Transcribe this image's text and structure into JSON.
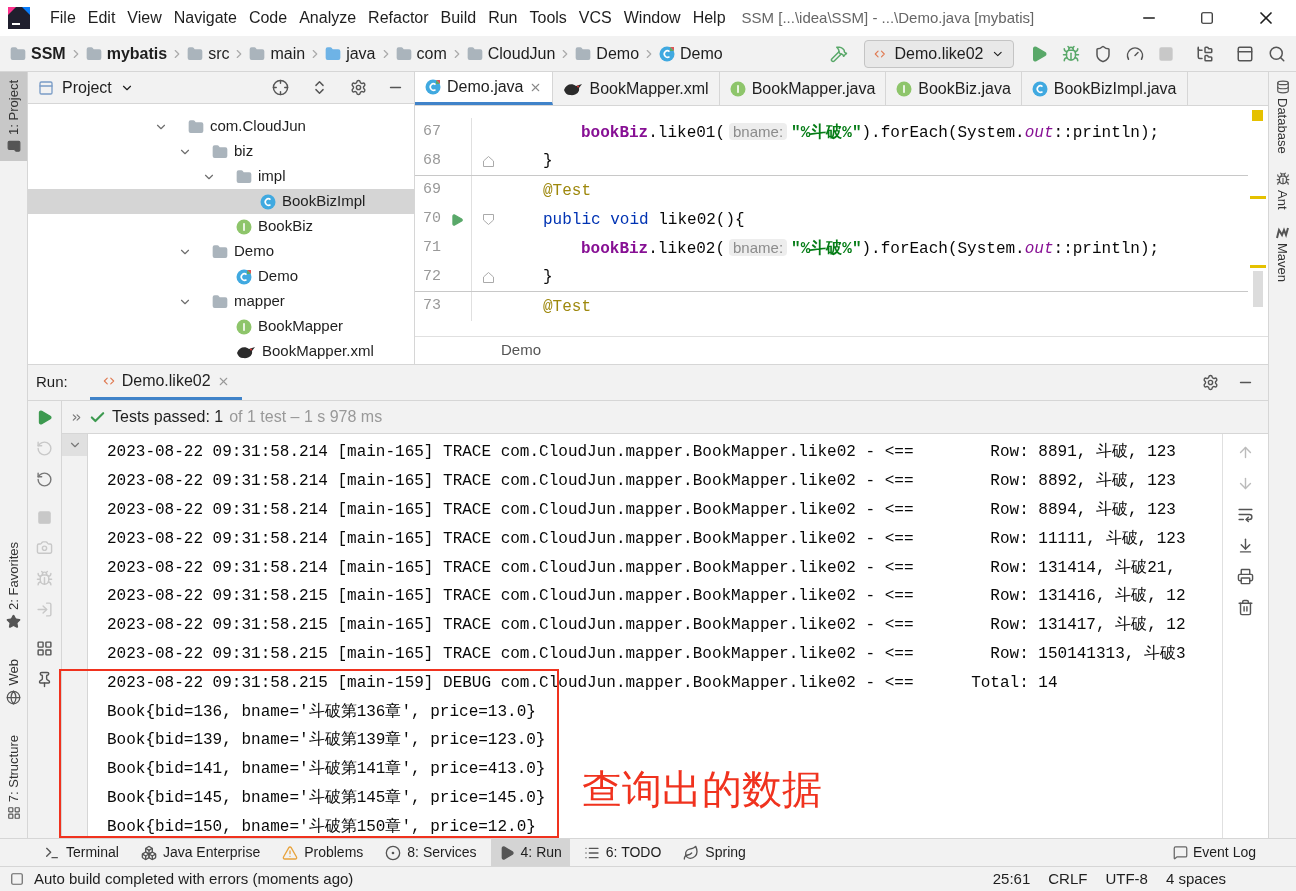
{
  "title_bar": {
    "menu": [
      "File",
      "Edit",
      "View",
      "Navigate",
      "Code",
      "Analyze",
      "Refactor",
      "Build",
      "Run",
      "Tools",
      "VCS",
      "Window",
      "Help"
    ],
    "title": "SSM [...\\idea\\SSM] - ...\\Demo.java [mybatis]"
  },
  "nav_bar": {
    "breadcrumbs": [
      {
        "label": "SSM",
        "kind": "module"
      },
      {
        "label": "mybatis",
        "kind": "module"
      },
      {
        "label": "src",
        "kind": "folder"
      },
      {
        "label": "main",
        "kind": "folder"
      },
      {
        "label": "java",
        "kind": "source"
      },
      {
        "label": "com",
        "kind": "folder"
      },
      {
        "label": "CloudJun",
        "kind": "folder"
      },
      {
        "label": "Demo",
        "kind": "folder"
      },
      {
        "label": "Demo",
        "kind": "class"
      }
    ],
    "run_config": "Demo.like02"
  },
  "left_strip": {
    "tabs": [
      {
        "label": "1: Project",
        "kind": "project",
        "selected": true
      },
      {
        "label": "2: Favorites",
        "kind": "favorites",
        "selected": false
      },
      {
        "label": "Web",
        "kind": "web",
        "selected": false
      },
      {
        "label": "7: Structure",
        "kind": "structure",
        "selected": false
      }
    ]
  },
  "right_strip": {
    "tabs": [
      {
        "label": "Database",
        "kind": "database"
      },
      {
        "label": "Ant",
        "kind": "ant"
      },
      {
        "label": "Maven",
        "kind": "maven"
      }
    ]
  },
  "project_panel": {
    "title": "Project",
    "tree": [
      {
        "label": "com.CloudJun",
        "kind": "package",
        "expanded": true,
        "selected": false,
        "children": [
          {
            "label": "biz",
            "kind": "package",
            "expanded": true,
            "selected": false,
            "children": [
              {
                "label": "impl",
                "kind": "package",
                "expanded": true,
                "selected": false,
                "children": [
                  {
                    "label": "BookBizImpl",
                    "kind": "class",
                    "selected": true
                  }
                ]
              },
              {
                "label": "BookBiz",
                "kind": "interface",
                "selected": false
              }
            ]
          },
          {
            "label": "Demo",
            "kind": "package",
            "expanded": true,
            "selected": false,
            "children": [
              {
                "label": "Demo",
                "kind": "test-class",
                "selected": false
              }
            ]
          },
          {
            "label": "mapper",
            "kind": "package",
            "expanded": true,
            "selected": false,
            "children": [
              {
                "label": "BookMapper",
                "kind": "interface",
                "selected": false
              },
              {
                "label": "BookMapper.xml",
                "kind": "xml",
                "selected": false
              }
            ]
          }
        ]
      }
    ]
  },
  "editor": {
    "tabs": [
      {
        "label": "Demo.java",
        "kind": "test-class",
        "selected": true
      },
      {
        "label": "BookMapper.xml",
        "kind": "xml",
        "selected": false
      },
      {
        "label": "BookMapper.java",
        "kind": "interface",
        "selected": false
      },
      {
        "label": "BookBiz.java",
        "kind": "interface",
        "selected": false
      },
      {
        "label": "BookBizImpl.java",
        "kind": "class",
        "selected": false
      }
    ],
    "lines": [
      {
        "number": "67",
        "kind": "statement",
        "run_marker": false,
        "separator": false,
        "tokens": [
          {
            "kind": "field",
            "text": "bookBiz"
          },
          {
            "kind": "plain",
            "text": ".like01("
          },
          {
            "kind": "hint",
            "text": "bname:"
          },
          {
            "kind": "string",
            "text": "\"%斗破%\""
          },
          {
            "kind": "plain",
            "text": ").forEach(System."
          },
          {
            "kind": "static",
            "text": "out"
          },
          {
            "kind": "plain",
            "text": "::println);"
          }
        ]
      },
      {
        "number": "68",
        "kind": "close",
        "run_marker": false,
        "separator": true,
        "tokens": [
          {
            "kind": "plain",
            "text": "}"
          }
        ]
      },
      {
        "number": "69",
        "kind": "annotation",
        "run_marker": false,
        "separator": false,
        "tokens": [
          {
            "kind": "annotation",
            "text": "@Test"
          }
        ]
      },
      {
        "number": "70",
        "kind": "signature",
        "run_marker": true,
        "separator": false,
        "tokens": [
          {
            "kind": "keyword",
            "text": "public void "
          },
          {
            "kind": "plain",
            "text": "like02(){"
          }
        ]
      },
      {
        "number": "71",
        "kind": "statement",
        "run_marker": false,
        "separator": false,
        "tokens": [
          {
            "kind": "field",
            "text": "bookBiz"
          },
          {
            "kind": "plain",
            "text": ".like02("
          },
          {
            "kind": "hint",
            "text": "bname:"
          },
          {
            "kind": "string",
            "text": "\"%斗破%\""
          },
          {
            "kind": "plain",
            "text": ").forEach(System."
          },
          {
            "kind": "static",
            "text": "out"
          },
          {
            "kind": "plain",
            "text": "::println);"
          }
        ]
      },
      {
        "number": "72",
        "kind": "close",
        "run_marker": false,
        "separator": true,
        "tokens": [
          {
            "kind": "plain",
            "text": "}"
          }
        ]
      },
      {
        "number": "73",
        "kind": "annotation",
        "run_marker": false,
        "separator": false,
        "tokens": [
          {
            "kind": "annotation",
            "text": "@Test"
          }
        ]
      }
    ],
    "breadcrumb": "Demo"
  },
  "run_panel": {
    "label": "Run:",
    "tabs": [
      {
        "label": "Demo.like02",
        "selected": true
      }
    ],
    "test_status": {
      "passed": "Tests passed: 1",
      "detail": "of 1 test – 1 s 978 ms"
    },
    "console": [
      "2023-08-22 09:31:58.214 [main-165] TRACE com.CloudJun.mapper.BookMapper.like02 - <==        Row: 8891, 斗破, 123",
      "2023-08-22 09:31:58.214 [main-165] TRACE com.CloudJun.mapper.BookMapper.like02 - <==        Row: 8892, 斗破, 123",
      "2023-08-22 09:31:58.214 [main-165] TRACE com.CloudJun.mapper.BookMapper.like02 - <==        Row: 8894, 斗破, 123",
      "2023-08-22 09:31:58.214 [main-165] TRACE com.CloudJun.mapper.BookMapper.like02 - <==        Row: 11111, 斗破, 123",
      "2023-08-22 09:31:58.214 [main-165] TRACE com.CloudJun.mapper.BookMapper.like02 - <==        Row: 131414, 斗破21,",
      "2023-08-22 09:31:58.215 [main-165] TRACE com.CloudJun.mapper.BookMapper.like02 - <==        Row: 131416, 斗破, 12",
      "2023-08-22 09:31:58.215 [main-165] TRACE com.CloudJun.mapper.BookMapper.like02 - <==        Row: 131417, 斗破, 12",
      "2023-08-22 09:31:58.215 [main-165] TRACE com.CloudJun.mapper.BookMapper.like02 - <==        Row: 150141313, 斗破3",
      "2023-08-22 09:31:58.215 [main-159] DEBUG com.CloudJun.mapper.BookMapper.like02 - <==      Total: 14",
      "Book{bid=136, bname='斗破第136章', price=13.0}",
      "Book{bid=139, bname='斗破第139章', price=123.0}",
      "Book{bid=141, bname='斗破第141章', price=413.0}",
      "Book{bid=145, bname='斗破第145章', price=145.0}",
      "Book{bid=150, bname='斗破第150章', price=12.0}"
    ],
    "annotation": "查询出的数据"
  },
  "tool_bar": {
    "items": [
      {
        "label": "Terminal",
        "kind": "terminal",
        "selected": false
      },
      {
        "label": "Java Enterprise",
        "kind": "enterprise",
        "selected": false
      },
      {
        "label": "Problems",
        "kind": "problems",
        "selected": false
      },
      {
        "label": "8: Services",
        "kind": "services",
        "selected": false
      },
      {
        "label": "4: Run",
        "kind": "run",
        "selected": true
      },
      {
        "label": "6: TODO",
        "kind": "todo",
        "selected": false
      },
      {
        "label": "Spring",
        "kind": "spring",
        "selected": false
      }
    ],
    "event_log": "Event Log"
  },
  "status_bar": {
    "message": "Auto build completed with errors (moments ago)",
    "items": [
      "25:61",
      "CRLF",
      "UTF-8",
      "4 spaces"
    ]
  }
}
